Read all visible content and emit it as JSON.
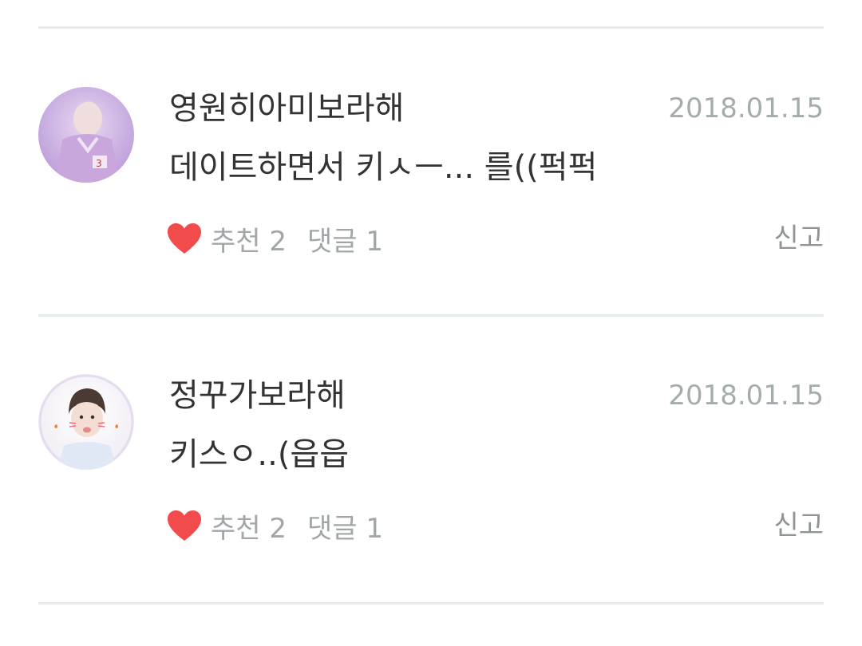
{
  "comments": [
    {
      "username": "영원히아미보라해",
      "date": "2018.01.15",
      "text": "데이트하면서 키ㅅㅡ... 를((퍽퍽",
      "like_label": "추천 2",
      "reply_label": "댓글 1",
      "report_label": "신고",
      "avatar_icon": "avatar-photo-purple-icon",
      "heart_icon": "heart-icon"
    },
    {
      "username": "정꾸가보라해",
      "date": "2018.01.15",
      "text": "키스ㅇ..(읍읍",
      "like_label": "추천 2",
      "reply_label": "댓글 1",
      "report_label": "신고",
      "avatar_icon": "avatar-photo-icon",
      "heart_icon": "heart-icon"
    }
  ],
  "colors": {
    "heart": "#f14b4b",
    "divider": "#e6ece9",
    "meta_text": "#a1a7a8",
    "date_text": "#a4acad"
  }
}
